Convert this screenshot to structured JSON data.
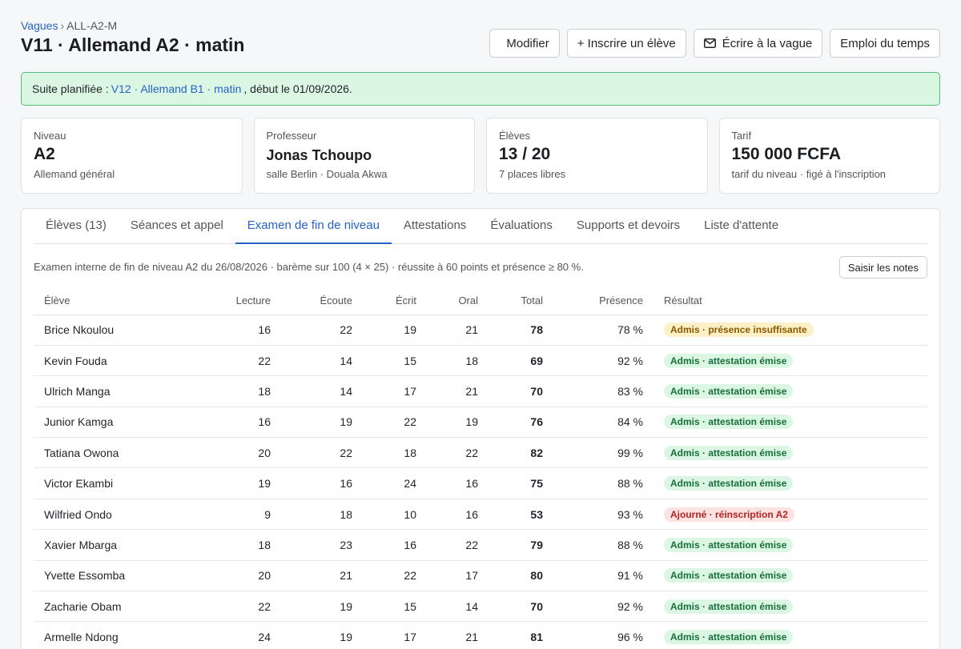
{
  "breadcrumb": {
    "parent": "Vagues",
    "separator": "›",
    "current": "ALL-A2-M"
  },
  "title": "V11 · Allemand A2 · matin",
  "actions": {
    "modify": "Modifier",
    "enroll": "+ Inscrire un élève",
    "write": "Écrire à la vague",
    "schedule": "Emploi du temps"
  },
  "notice": {
    "prefix": "Suite planifiée :",
    "link": "V12 · Allemand B1 · matin",
    "suffix": ", début le 01/09/2026."
  },
  "cards": [
    {
      "label": "Niveau",
      "value": "A2",
      "sub": "Allemand général"
    },
    {
      "label": "Professeur",
      "value": "Jonas Tchoupo",
      "sub": "salle Berlin · Douala Akwa"
    },
    {
      "label": "Élèves",
      "value": "13 / 20",
      "sub": "7 places libres"
    },
    {
      "label": "Tarif",
      "value": "150 000 FCFA",
      "sub": "tarif du niveau · figé à l'inscription"
    }
  ],
  "tabs": [
    "Élèves (13)",
    "Séances et appel",
    "Examen de fin de niveau",
    "Attestations",
    "Évaluations",
    "Supports et devoirs",
    "Liste d'attente"
  ],
  "active_tab": 2,
  "exam": {
    "description": "Examen interne de fin de niveau A2 du 26/08/2026 · barème sur 100 (4 × 25) · réussite à 60 points et présence ≥ 80 %.",
    "enter_notes": "Saisir les notes",
    "columns": [
      "Élève",
      "Lecture",
      "Écoute",
      "Écrit",
      "Oral",
      "Total",
      "Présence",
      "Résultat"
    ],
    "rows": [
      {
        "name": "Brice Nkoulou",
        "lecture": "16",
        "ecoute": "22",
        "ecrit": "19",
        "oral": "21",
        "total": "78",
        "presence": "78 %",
        "result": "Admis · présence insuffisante",
        "status": "warn"
      },
      {
        "name": "Kevin Fouda",
        "lecture": "22",
        "ecoute": "14",
        "ecrit": "15",
        "oral": "18",
        "total": "69",
        "presence": "92 %",
        "result": "Admis · attestation émise",
        "status": "ok"
      },
      {
        "name": "Ulrich Manga",
        "lecture": "18",
        "ecoute": "14",
        "ecrit": "17",
        "oral": "21",
        "total": "70",
        "presence": "83 %",
        "result": "Admis · attestation émise",
        "status": "ok"
      },
      {
        "name": "Junior Kamga",
        "lecture": "16",
        "ecoute": "19",
        "ecrit": "22",
        "oral": "19",
        "total": "76",
        "presence": "84 %",
        "result": "Admis · attestation émise",
        "status": "ok"
      },
      {
        "name": "Tatiana Owona",
        "lecture": "20",
        "ecoute": "22",
        "ecrit": "18",
        "oral": "22",
        "total": "82",
        "presence": "99 %",
        "result": "Admis · attestation émise",
        "status": "ok"
      },
      {
        "name": "Victor Ekambi",
        "lecture": "19",
        "ecoute": "16",
        "ecrit": "24",
        "oral": "16",
        "total": "75",
        "presence": "88 %",
        "result": "Admis · attestation émise",
        "status": "ok"
      },
      {
        "name": "Wilfried Ondo",
        "lecture": "9",
        "ecoute": "18",
        "ecrit": "10",
        "oral": "16",
        "total": "53",
        "presence": "93 %",
        "result": "Ajourné · réinscription A2",
        "status": "bad"
      },
      {
        "name": "Xavier Mbarga",
        "lecture": "18",
        "ecoute": "23",
        "ecrit": "16",
        "oral": "22",
        "total": "79",
        "presence": "88 %",
        "result": "Admis · attestation émise",
        "status": "ok"
      },
      {
        "name": "Yvette Essomba",
        "lecture": "20",
        "ecoute": "21",
        "ecrit": "22",
        "oral": "17",
        "total": "80",
        "presence": "91 %",
        "result": "Admis · attestation émise",
        "status": "ok"
      },
      {
        "name": "Zacharie Obam",
        "lecture": "22",
        "ecoute": "19",
        "ecrit": "15",
        "oral": "14",
        "total": "70",
        "presence": "92 %",
        "result": "Admis · attestation émise",
        "status": "ok"
      },
      {
        "name": "Armelle Ndong",
        "lecture": "24",
        "ecoute": "19",
        "ecrit": "17",
        "oral": "21",
        "total": "81",
        "presence": "96 %",
        "result": "Admis · attestation émise",
        "status": "ok"
      }
    ]
  },
  "colors": {
    "accent": "#2563c9",
    "success_bg": "#dcf6e4",
    "success_border": "#4fbf7a",
    "warn_bg": "#fdf0c6",
    "danger_bg": "#fde2e2"
  },
  "icons": {
    "write": "envelope-icon"
  }
}
